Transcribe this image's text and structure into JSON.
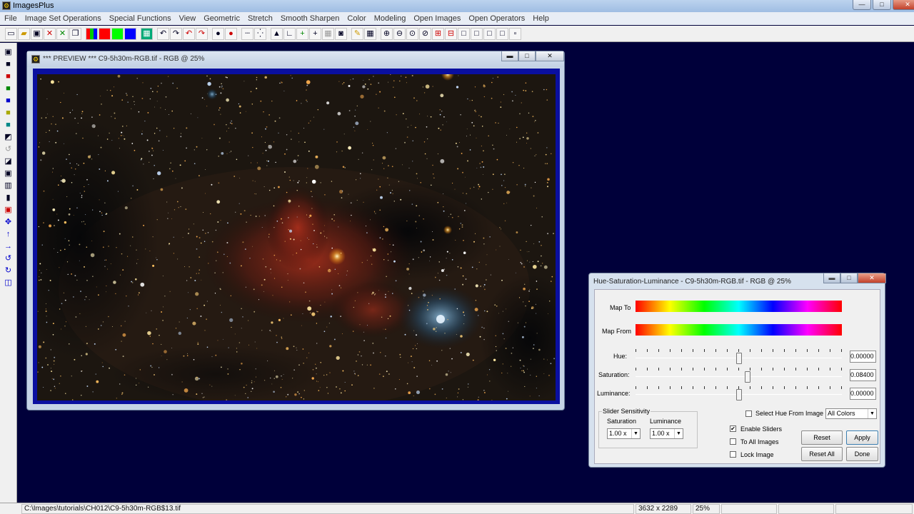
{
  "app": {
    "title": "ImagesPlus",
    "icon": "gear-icon"
  },
  "window_buttons": {
    "minimize": "—",
    "maximize": "□",
    "close": "✕"
  },
  "menu": [
    "File",
    "Image Set Operations",
    "Special Functions",
    "View",
    "Geometric",
    "Stretch",
    "Smooth Sharpen",
    "Color",
    "Modeling",
    "Open Images",
    "Open Operators",
    "Help"
  ],
  "preview": {
    "title": "*** PREVIEW *** C9-5h30m-RGB.tif - RGB @ 25%",
    "minimize": "▬",
    "maximize": "□",
    "close": "✕"
  },
  "hsl": {
    "title": "Hue-Saturation-Luminance - C9-5h30m-RGB.tif - RGB @ 25%",
    "map_to_label": "Map To",
    "map_from_label": "Map From",
    "hue": {
      "label": "Hue:",
      "value": "0.00000",
      "level": 0.5
    },
    "saturation": {
      "label": "Saturation:",
      "value": "0.08400",
      "level": 0.542
    },
    "luminance": {
      "label": "Luminance:",
      "value": "0.00000",
      "level": 0.5
    },
    "sensitivity": {
      "group_label": "Slider Sensitivity",
      "saturation_label": "Saturation",
      "luminance_label": "Luminance",
      "saturation_value": "1.00 x",
      "luminance_value": "1.00 x"
    },
    "select_hue_label": "Select Hue From Image",
    "select_hue_checked": false,
    "color_select": "All Colors",
    "enable_sliders_label": "Enable Sliders",
    "enable_sliders_checked": true,
    "to_all_images_label": "To All Images",
    "lock_image_label": "Lock Image",
    "buttons": {
      "reset": "Reset",
      "apply": "Apply",
      "reset_all": "Reset All",
      "done": "Done"
    }
  },
  "status": {
    "path": "C:\\Images\\tutorials\\CH012\\C9-5h30m-RGB$13.tif",
    "dimensions": "3632 x 2289",
    "zoom": "25%"
  }
}
